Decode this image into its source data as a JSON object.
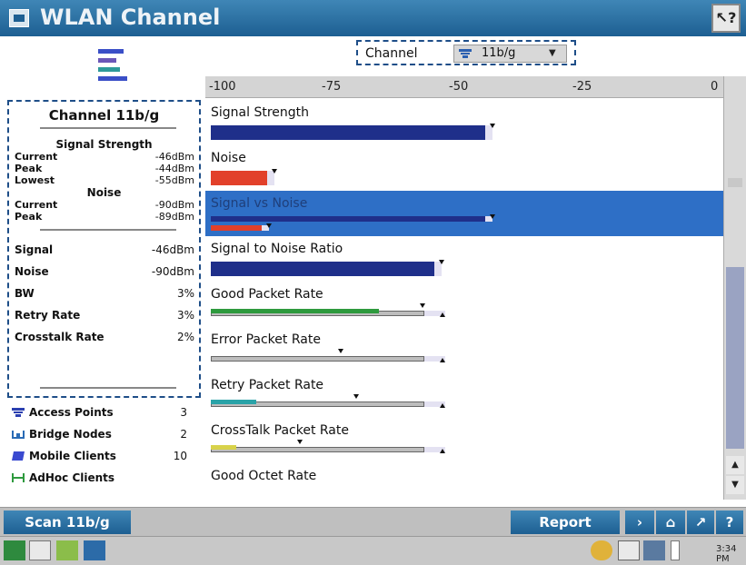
{
  "window": {
    "title": "WLAN Channel",
    "help_icon": "help-pointer-icon"
  },
  "channel_selector": {
    "label": "Channel",
    "value": "11b/g",
    "icon": "channel-antenna-icon"
  },
  "left_panel": {
    "title": "Channel 11b/g",
    "signal_header": "Signal Strength",
    "signal_rows": [
      {
        "label": "Current",
        "value": "-46dBm"
      },
      {
        "label": "Peak",
        "value": "-44dBm"
      },
      {
        "label": "Lowest",
        "value": "-55dBm"
      }
    ],
    "noise_header": "Noise",
    "noise_rows": [
      {
        "label": "Current",
        "value": "-90dBm"
      },
      {
        "label": "Peak",
        "value": "-89dBm"
      }
    ],
    "summary_rows": [
      {
        "label": "Signal",
        "value": "-46dBm"
      },
      {
        "label": "Noise",
        "value": "-90dBm"
      },
      {
        "label": "BW",
        "value": "3%"
      },
      {
        "label": "Retry Rate",
        "value": "3%"
      },
      {
        "label": "Crosstalk Rate",
        "value": "2%"
      }
    ]
  },
  "counts": [
    {
      "label": "Access Points",
      "value": "3",
      "icon": "access-point-icon",
      "color": "#2b3fb0"
    },
    {
      "label": "Bridge Nodes",
      "value": "2",
      "icon": "bridge-node-icon",
      "color": "#2a6bb5"
    },
    {
      "label": "Mobile Clients",
      "value": "10",
      "icon": "mobile-client-icon",
      "color": "#3a4ad0"
    },
    {
      "label": "AdHoc Clients",
      "value": "",
      "icon": "adhoc-client-icon",
      "color": "#2e9a3e"
    }
  ],
  "scale": {
    "labels": [
      "-100",
      "-75",
      "-50",
      "-25",
      "0"
    ],
    "min": -100,
    "max": 0
  },
  "metrics": [
    {
      "label": "Signal Strength",
      "selected": false,
      "bars": [
        {
          "kind": "dbm",
          "value": -46,
          "color": "#1f2f8a",
          "marker": "down"
        }
      ]
    },
    {
      "label": "Noise",
      "selected": false,
      "bars": [
        {
          "kind": "dbm",
          "value": -89,
          "color": "#e2402a",
          "marker": "down"
        }
      ]
    },
    {
      "label": "Signal vs Noise",
      "selected": true,
      "bars": [
        {
          "kind": "dbm",
          "value": -46,
          "color": "#1f2f8a",
          "marker": "down"
        },
        {
          "kind": "dbm",
          "value": -90,
          "color": "#e2402a",
          "marker": "down"
        }
      ]
    },
    {
      "label": "Signal to Noise Ratio",
      "selected": false,
      "bars": [
        {
          "kind": "dbm",
          "value": -56,
          "color": "#1f2f8a",
          "marker": "down"
        }
      ]
    },
    {
      "label": "Good Packet Rate",
      "selected": false,
      "bars": [
        {
          "kind": "rate",
          "fill": 0.33,
          "fill_color": "#2e9a3e",
          "track_fraction": 0.42,
          "peak": 0.41,
          "marker2": 0.45
        }
      ]
    },
    {
      "label": "Error Packet Rate",
      "selected": false,
      "bars": [
        {
          "kind": "rate",
          "fill": 0.0,
          "fill_color": "#9c9c9c",
          "track_fraction": 0.42,
          "peak": 0.25,
          "marker2": 0.45
        }
      ]
    },
    {
      "label": "Retry Packet Rate",
      "selected": false,
      "bars": [
        {
          "kind": "rate",
          "fill": 0.09,
          "fill_color": "#2aa3a8",
          "track_fraction": 0.42,
          "peak": 0.28,
          "marker2": 0.45
        }
      ]
    },
    {
      "label": "CrossTalk Packet Rate",
      "selected": false,
      "bars": [
        {
          "kind": "rate",
          "fill": 0.05,
          "fill_color": "#d8d24a",
          "track_fraction": 0.42,
          "peak": 0.17,
          "marker2": 0.45
        }
      ]
    },
    {
      "label": "Good Octet Rate",
      "selected": false,
      "bars": []
    }
  ],
  "toolbar": {
    "scan_label": "Scan 11b/g",
    "report_label": "Report",
    "nav_icons": [
      "forward-icon",
      "home-icon",
      "tools-icon",
      "help-icon"
    ],
    "nav_glyphs": [
      "›",
      "⌂",
      "↗",
      "?"
    ]
  },
  "taskbar": {
    "clock": "3:34 PM"
  }
}
